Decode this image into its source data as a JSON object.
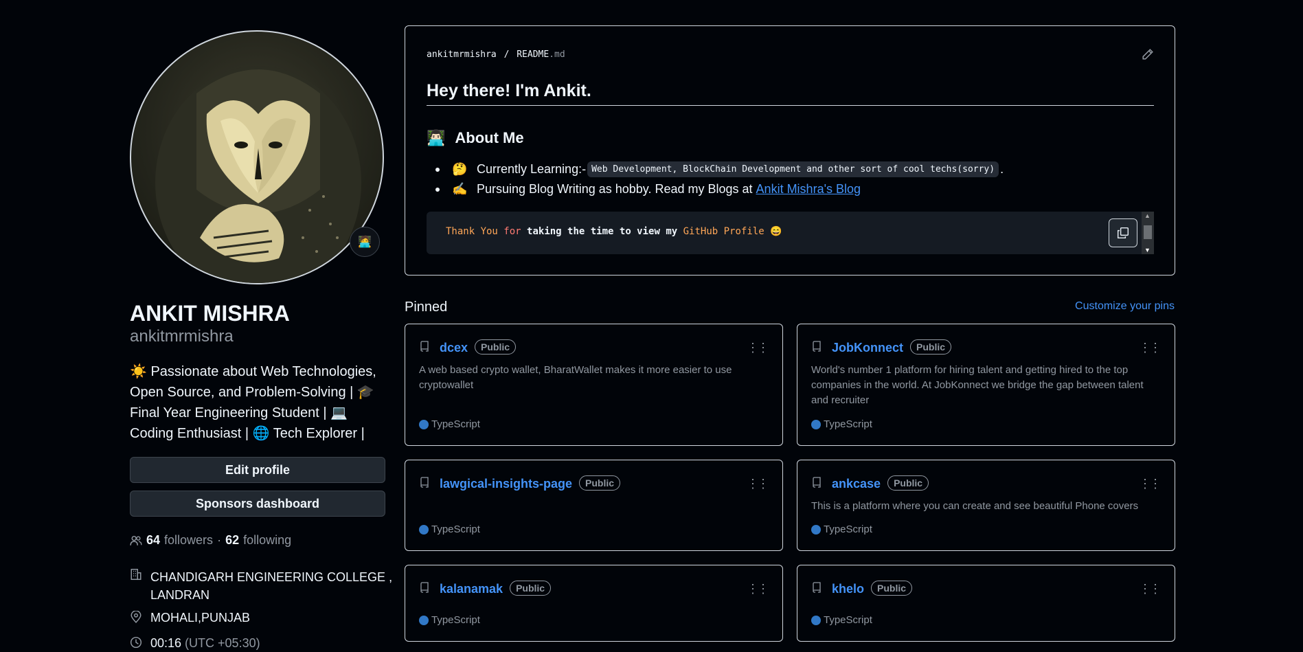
{
  "profile": {
    "name": "ANKIT MISHRA",
    "login": "ankitmrmishra",
    "status_emoji": "🧑‍💻",
    "bio": "☀️ Passionate about Web Technologies, Open Source, and Problem-Solving | 🎓 Final Year Engineering Student | 💻 Coding Enthusiast | 🌐 Tech Explorer |",
    "edit_label": "Edit profile",
    "sponsors_label": "Sponsors dashboard",
    "followers_count": "64",
    "followers_label": "followers",
    "separator": "·",
    "following_count": "62",
    "following_label": "following",
    "organization": "CHANDIGARH ENGINEERING COLLEGE ,",
    "organization_line2": "LANDRAN",
    "location": "MOHALI,PUNJAB",
    "local_time": "00:16",
    "timezone": "(UTC +05:30)"
  },
  "readme": {
    "owner": "ankitmrmishra",
    "file": "README",
    "ext": ".md",
    "heading": "Hey there! I'm Ankit.",
    "about_emoji": "👨🏻‍💻",
    "about_heading": "About Me",
    "item1_emoji": "🤔",
    "item1_text": "Currently Learning:-",
    "item1_code": "Web Development, BlockChain Development and other sort of cool techs(sorry)",
    "item1_end": ".",
    "item2_emoji": "✍️",
    "item2_text": "Pursuing Blog Writing as hobby. Read my Blogs at",
    "item2_link": "Ankit Mishra's Blog",
    "code_thank": "Thank You",
    "code_for": "for",
    "code_mid": "taking the time to view my",
    "code_gh": "GitHub Profile",
    "code_emoji": "😄"
  },
  "pinned": {
    "title": "Pinned",
    "customize": "Customize your pins",
    "repos": [
      {
        "name": "dcex",
        "visibility": "Public",
        "description": "A web based crypto wallet, BharatWallet makes it more easier to use cryptowallet",
        "language": "TypeScript"
      },
      {
        "name": "JobKonnect",
        "visibility": "Public",
        "description": "World's number 1 platform for hiring talent and getting hired to the top companies in the world. At JobKonnect we bridge the gap between talent and recruiter",
        "language": "TypeScript"
      },
      {
        "name": "lawgical-insights-page",
        "visibility": "Public",
        "description": "",
        "language": "TypeScript"
      },
      {
        "name": "ankcase",
        "visibility": "Public",
        "description": "This is a platform where you can create and see beautiful Phone covers",
        "language": "TypeScript"
      },
      {
        "name": "kalanamak",
        "visibility": "Public",
        "description": "",
        "language": "TypeScript"
      },
      {
        "name": "khelo",
        "visibility": "Public",
        "description": "",
        "language": "TypeScript"
      }
    ]
  },
  "colors": {
    "background": "#010409",
    "link": "#4493f8",
    "typescript": "#3178c6"
  }
}
